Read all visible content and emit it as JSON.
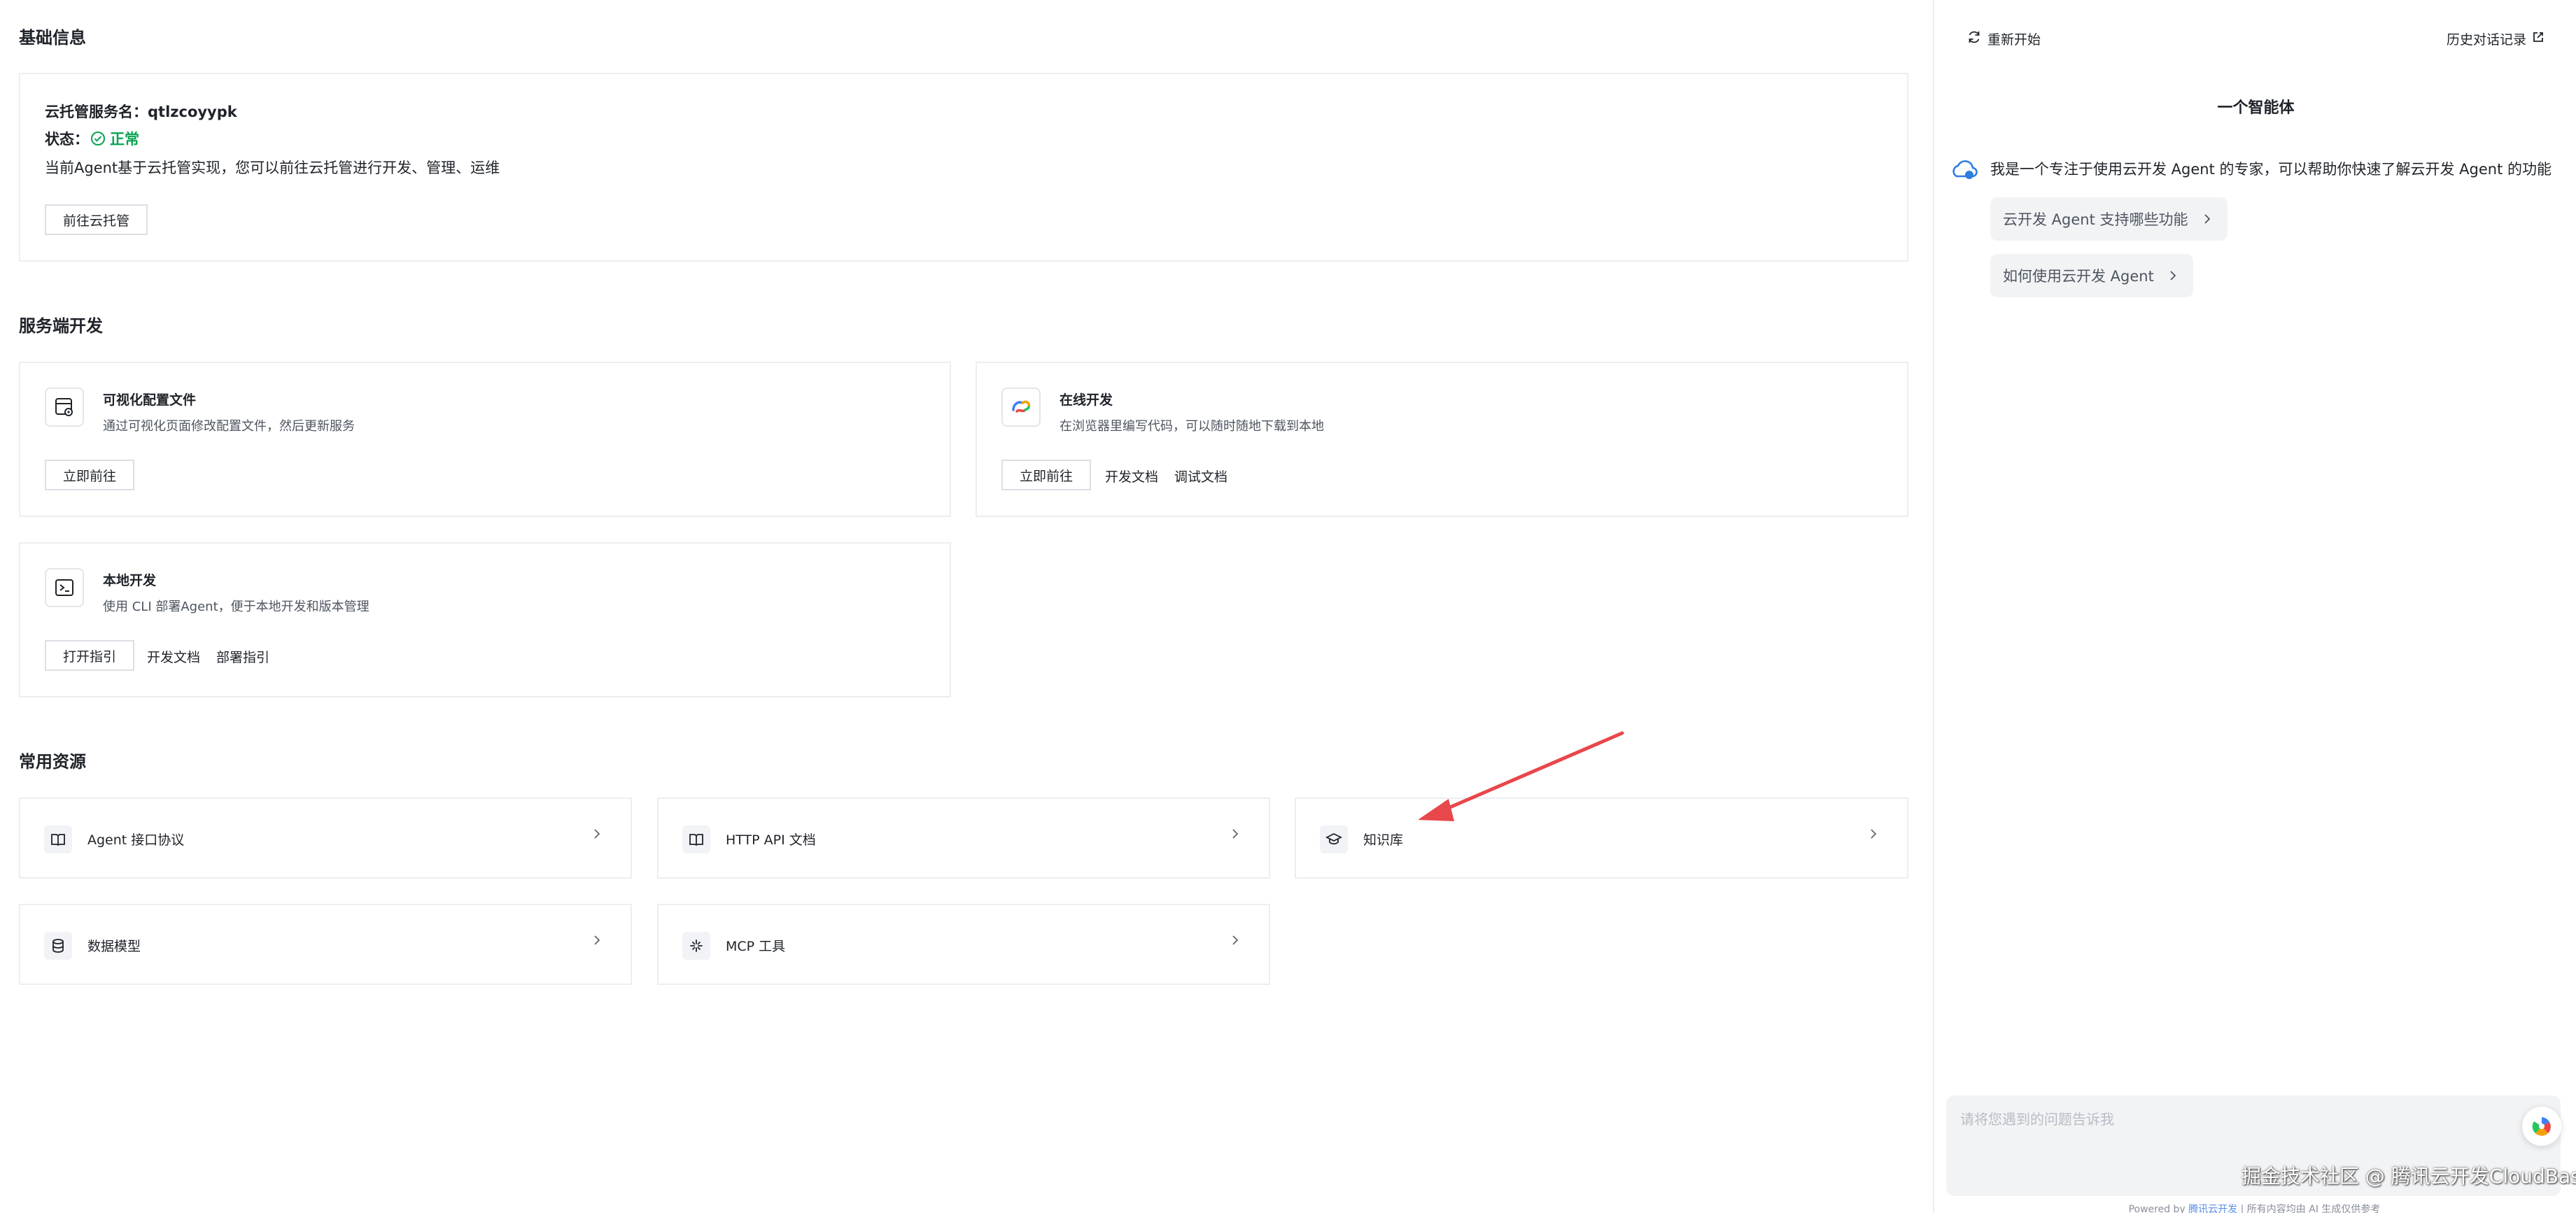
{
  "basic_info": {
    "section_title": "基础信息",
    "service_label": "云托管服务名：",
    "service_name": "qtlzcoyypk",
    "status_label": "状态：",
    "status_value": "正常",
    "description": "当前Agent基于云托管实现，您可以前往云托管进行开发、管理、运维",
    "goto_button": "前往云托管"
  },
  "server_dev": {
    "section_title": "服务端开发",
    "cards": [
      {
        "title": "可视化配置文件",
        "desc": "通过可视化页面修改配置文件，然后更新服务",
        "primary": "立即前往",
        "links": []
      },
      {
        "title": "在线开发",
        "desc": "在浏览器里编写代码，可以随时随地下载到本地",
        "primary": "立即前往",
        "links": [
          "开发文档",
          "调试文档"
        ]
      },
      {
        "title": "本地开发",
        "desc": "使用 CLI 部署Agent，便于本地开发和版本管理",
        "primary": "打开指引",
        "links": [
          "开发文档",
          "部署指引"
        ]
      }
    ]
  },
  "resources": {
    "section_title": "常用资源",
    "items": [
      {
        "label": "Agent 接口协议",
        "icon": "book-icon"
      },
      {
        "label": "HTTP API 文档",
        "icon": "book-icon"
      },
      {
        "label": "知识库",
        "icon": "graduation-cap-icon"
      },
      {
        "label": "数据模型",
        "icon": "database-icon"
      },
      {
        "label": "MCP 工具",
        "icon": "sparkle-icon"
      }
    ]
  },
  "chat_panel": {
    "restart_label": "重新开始",
    "history_label": "历史对话记录",
    "agent_name": "一个智能体",
    "agent_message": "我是一个专注于使用云开发 Agent 的专家，可以帮助你快速了解云开发 Agent 的功能",
    "suggestions": [
      "云开发 Agent 支持哪些功能",
      "如何使用云开发 Agent"
    ],
    "input_placeholder": "请将您遇到的问题告诉我",
    "footer_prefix": "Powered by ",
    "footer_brand": "腾讯云开发",
    "footer_suffix": " | 所有内容均由 AI 生成仅供参考"
  },
  "watermark": "掘金技术社区 @ 腾讯云开发CloudBase",
  "colors": {
    "status_ok": "#0aa352",
    "annotation_arrow": "#e8474c",
    "border": "#eceef2"
  }
}
